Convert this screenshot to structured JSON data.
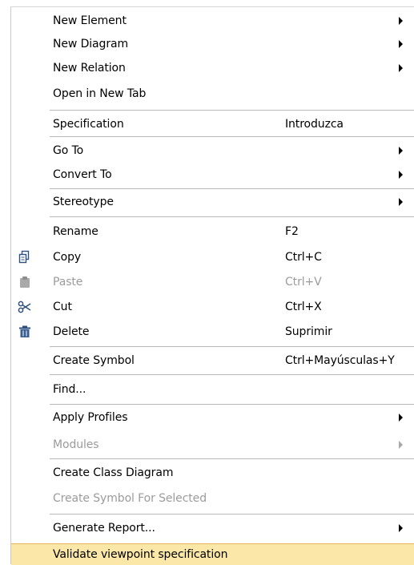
{
  "menu": {
    "items": [
      {
        "label": "New Element",
        "shortcut": "",
        "submenu": true,
        "disabled": false
      },
      {
        "label": "New Diagram",
        "shortcut": "",
        "submenu": true,
        "disabled": false
      },
      {
        "label": "New Relation",
        "shortcut": "",
        "submenu": true,
        "disabled": false
      },
      {
        "label": "Open in New Tab",
        "shortcut": "",
        "submenu": false,
        "disabled": false
      },
      {
        "label": "Specification",
        "shortcut": "Introduzca",
        "submenu": false,
        "disabled": false
      },
      {
        "label": "Go To",
        "shortcut": "",
        "submenu": true,
        "disabled": false
      },
      {
        "label": "Convert To",
        "shortcut": "",
        "submenu": true,
        "disabled": false
      },
      {
        "label": "Stereotype",
        "shortcut": "",
        "submenu": true,
        "disabled": false
      },
      {
        "label": "Rename",
        "shortcut": "F2",
        "submenu": false,
        "disabled": false
      },
      {
        "label": "Copy",
        "shortcut": "Ctrl+C",
        "submenu": false,
        "disabled": false,
        "icon": "copy-icon"
      },
      {
        "label": "Paste",
        "shortcut": "Ctrl+V",
        "submenu": false,
        "disabled": true,
        "icon": "paste-icon"
      },
      {
        "label": "Cut",
        "shortcut": "Ctrl+X",
        "submenu": false,
        "disabled": false,
        "icon": "cut-icon"
      },
      {
        "label": "Delete",
        "shortcut": "Suprimir",
        "submenu": false,
        "disabled": false,
        "icon": "delete-icon"
      },
      {
        "label": "Create Symbol",
        "shortcut": "Ctrl+Mayúsculas+Y",
        "submenu": false,
        "disabled": false
      },
      {
        "label": "Find...",
        "shortcut": "",
        "submenu": false,
        "disabled": false
      },
      {
        "label": "Apply Profiles",
        "shortcut": "",
        "submenu": true,
        "disabled": false
      },
      {
        "label": "Modules",
        "shortcut": "",
        "submenu": true,
        "disabled": true
      },
      {
        "label": "Create Class Diagram",
        "shortcut": "",
        "submenu": false,
        "disabled": false
      },
      {
        "label": "Create Symbol For Selected",
        "shortcut": "",
        "submenu": false,
        "disabled": true
      },
      {
        "label": "Generate Report...",
        "shortcut": "",
        "submenu": true,
        "disabled": false
      },
      {
        "label": "Validate viewpoint specification",
        "shortcut": "",
        "submenu": false,
        "disabled": false,
        "highlighted": true
      }
    ]
  },
  "colors": {
    "highlight_background": "#fbe8a8",
    "highlight_border": "#e3b659",
    "disabled_text": "#9b9b9b",
    "icon_blue": "#3b5f93"
  }
}
